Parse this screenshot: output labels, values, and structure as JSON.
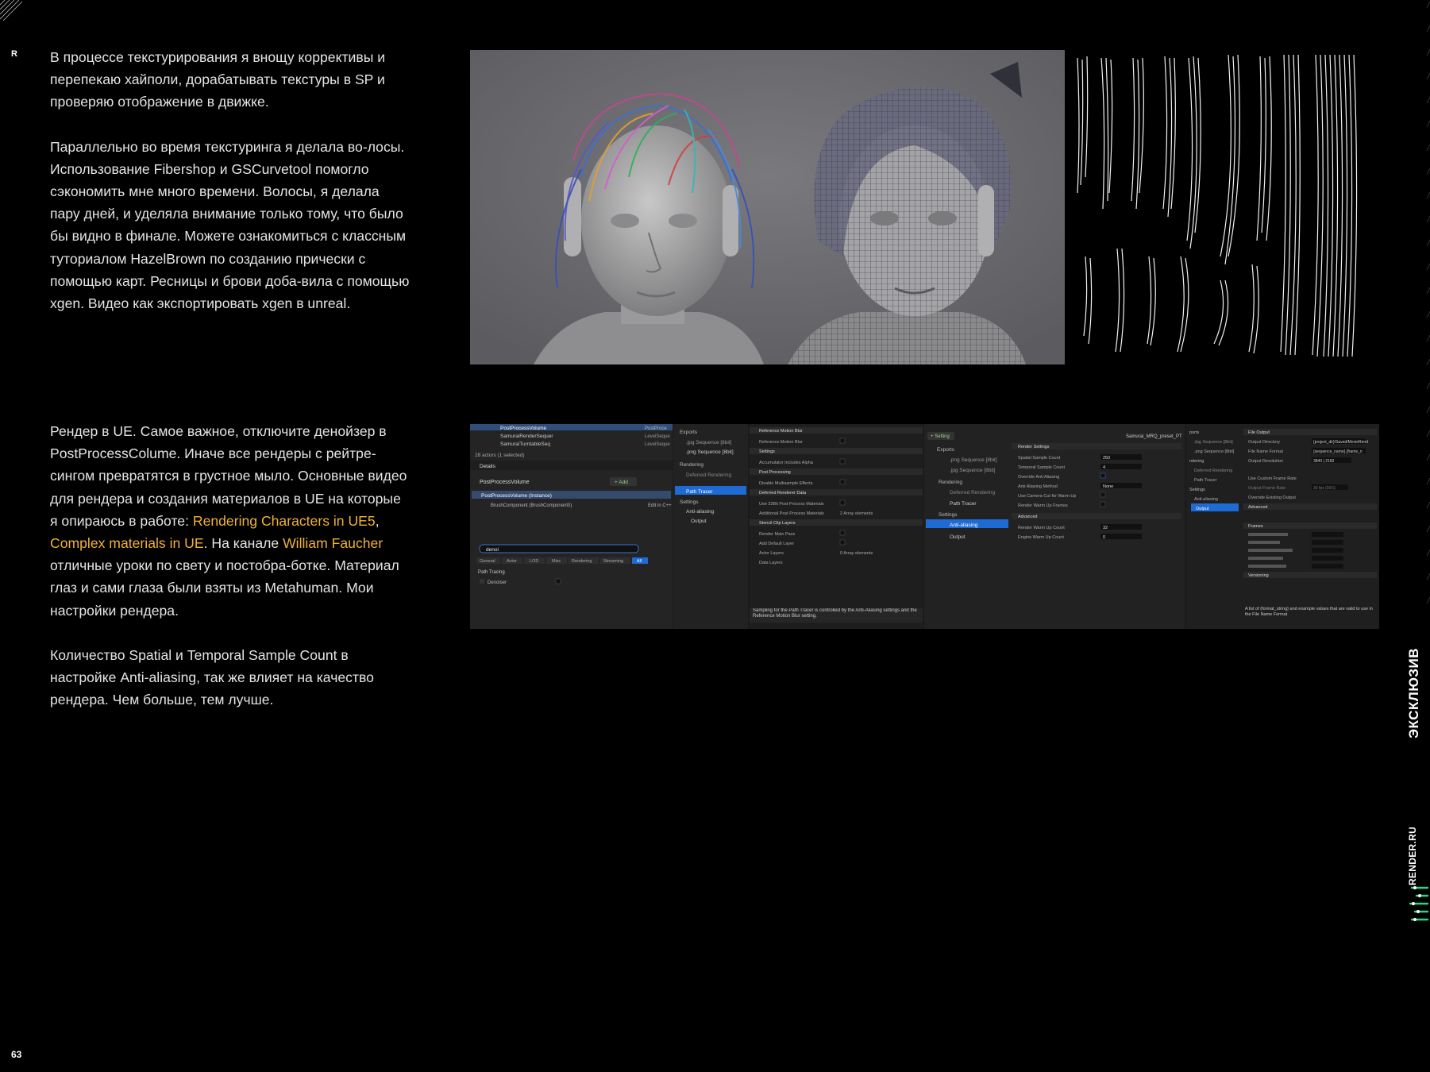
{
  "corner_letter": "R",
  "page_number": "63",
  "sidebar": {
    "label_exclusive": "ЭКСКЛЮЗИВ",
    "label_site": "RENDER.RU",
    "accent_color": "#2fd27a"
  },
  "column1": {
    "p1": "В процессе текстурирования я внощу коррективы и перепекаю хайполи, дорабатывать текстуры в SP и проверяю отображение в движке.",
    "p2": "Параллельно во время текстуринга я делала во-лосы. Использование Fibershop и GSCurvetool помогло сэкономить мне много времени. Волосы, я делала пару дней, и уделяла внимание только тому, что было бы видно в финале. Можете ознакомиться с классным туториалом HazelBrown по созданию прически с помощью карт. Ресницы и брови доба-вила с помощью xgen. Видео как экспортировать xgen в unreal."
  },
  "column2": {
    "p3_part1": "Рендер в UE. Самое важное, отключите денойзер в PostProcessColume. Иначе все рендеры с рейтре-сингом превратятся в грустное мыло. Основные видео для рендера и создания материалов в UE на которые я опираюсь в работе: ",
    "p3_link1": "Rendering Characters in UE5",
    "p3_sep": ", ",
    "p3_link2": "Complex materials in UE",
    "p3_part2": ". На канале ",
    "p3_link3": "William Faucher",
    "p3_part3": " отличные уроки по свету и постобра-ботке. Материал глаз и сами глаза были взяты из Metahuman. Мои настройки рендера.",
    "p4": "Количество Spatial и Temporal Sample Count в настройке Anti-aliasing, так же влияет на качество рендера. Чем больше, тем лучше.",
    "link_color": "#f0b233"
  },
  "ue_screenshot": {
    "outliner_rows": [
      "PostProcessVolume",
      "SamuraiRenderSequer",
      "SamuraiTurntableSeq"
    ],
    "outliner_type_col": [
      "PostProce",
      "LevelSeque",
      "LevelSeque"
    ],
    "actors_count": "28 actors (1 selected)",
    "details_tab": "Details",
    "details_object": "PostProcessVolume",
    "add_button": "+ Add",
    "instance_row": "PostProcessVolume (Instance)",
    "component_row": "BrushComponent (BrushComponent0)",
    "edit_link": "Edit in C++",
    "search_value": "denoi",
    "filter_tabs": [
      "General",
      "Actor",
      "LOD",
      "Misc",
      "Rendering",
      "Streaming",
      "All"
    ],
    "section_path_tracing": "Path Tracing",
    "denoiser_label": "Denoiser",
    "settings_tree_1": [
      "Exports",
      ".jpg Sequence [8bit]",
      ".png Sequence [8bit]",
      "Rendering",
      "Deferred Rendering",
      "Path Tracer",
      "Settings",
      "Anti-aliasing",
      "Output"
    ],
    "pt_sections": [
      {
        "label": "Reference Motion Blur",
        "rows": [
          "Reference Motion Blur"
        ]
      },
      {
        "label": "Settings",
        "rows": [
          "Accumulator Includes Alpha"
        ]
      },
      {
        "label": "Post Processing",
        "rows": [
          "Disable Multisample Effects"
        ]
      },
      {
        "label": "Deferred Renderer Data",
        "rows": [
          "Use 32Bit Post Process Materials",
          "Additional Post Process Materials"
        ]
      },
      {
        "label": "Stencil Clip Layers",
        "rows": [
          "Render Main Pass",
          "Add Default Layer",
          "Actor Layers",
          "Data Layers"
        ]
      }
    ],
    "array_value": "0 Array elements",
    "array_value_2": "2 Array elements",
    "tooltip": "Sampling for the Path Tracer is controlled by the Anti-Aliasing settings and the Reference Motion Blur setting.",
    "setting_button": "+ Setting",
    "preset_name": "Samurai_MRQ_preset_PT",
    "settings_tree_2": [
      "Exports",
      ".png Sequence [8bit]",
      ".jpg Sequence [8bit]",
      "Rendering",
      "Deferred Rendering",
      "Path Tracer",
      "Settings",
      "Anti-aliasing",
      "Output"
    ],
    "aa_header": "Render Settings",
    "aa_rows": [
      {
        "label": "Spatial Sample Count",
        "value": "250"
      },
      {
        "label": "Temporal Sample Count",
        "value": "4"
      },
      {
        "label": "Override Anti Aliasing",
        "value": ""
      },
      {
        "label": "Anti Aliasing Method",
        "value": "None"
      },
      {
        "label": "Use Camera Cut for Warm Up",
        "value": ""
      },
      {
        "label": "Render Warm Up Frames",
        "value": ""
      }
    ],
    "aa_advanced": "Advanced",
    "aa_adv_rows": [
      {
        "label": "Render Warm Up Count",
        "value": "32"
      },
      {
        "label": "Engine Warm Up Count",
        "value": "0"
      }
    ],
    "settings_tree_3": [
      "ports",
      "Jpg Sequence [8bit]",
      ".png Sequence [8bit]",
      "ndering",
      "Deferred Rendering",
      "Path Tracer",
      "Settings",
      "Anti-aliasing",
      "Output"
    ],
    "out_sections": [
      "File Output",
      "Advanced",
      "Frames",
      "Versioning"
    ],
    "out_rows": [
      {
        "label": "Output Directory",
        "value": "{project_dir}/Saved/MovieRend"
      },
      {
        "label": "File Name Format",
        "value": "{sequence_name}.{frame_n"
      },
      {
        "label": "Output Resolution",
        "value": "3840 | 2160"
      },
      {
        "label": "Use Custom Frame Rate",
        "value": ""
      },
      {
        "label": "Output Frame Rate",
        "value": "30 fps (30/1)"
      },
      {
        "label": "Override Existing Output",
        "value": ""
      }
    ],
    "out_tooltip": "A list of (format_string} and example values that are valid to use in the File Name Format"
  }
}
